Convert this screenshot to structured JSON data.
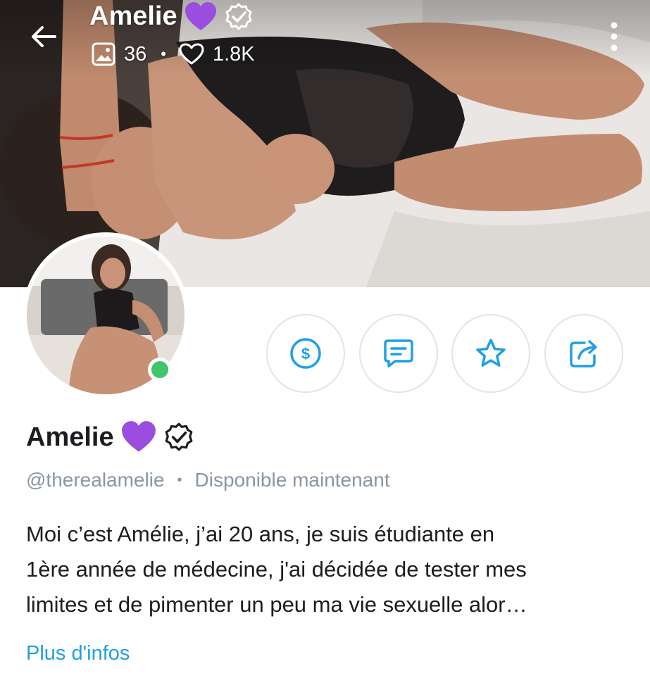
{
  "header": {
    "name": "Amelie",
    "media_count": "36",
    "likes_count": "1.8K",
    "dot": "•"
  },
  "profile": {
    "name": "Amelie",
    "username": "@therealamelie",
    "separator": "•",
    "status": "Disponible maintenant",
    "online": true
  },
  "bio": {
    "lines": [
      "Moi c’est Amélie, j’ai 20 ans, je suis étudiante en",
      "1ère année de médecine, j'ai décidée de tester mes",
      "limites et de pimenter un peu ma vie sexuelle alor…"
    ],
    "more_label": "Plus d'infos"
  },
  "actions": [
    {
      "icon": "dollar-icon"
    },
    {
      "icon": "message-icon"
    },
    {
      "icon": "star-icon"
    },
    {
      "icon": "share-icon"
    }
  ],
  "colors": {
    "accent": "#1ea0e6",
    "heart_purple": "#9b4de0",
    "online_green": "#3fc56b",
    "muted_text": "#8a96a3",
    "text": "#1d1d21"
  }
}
